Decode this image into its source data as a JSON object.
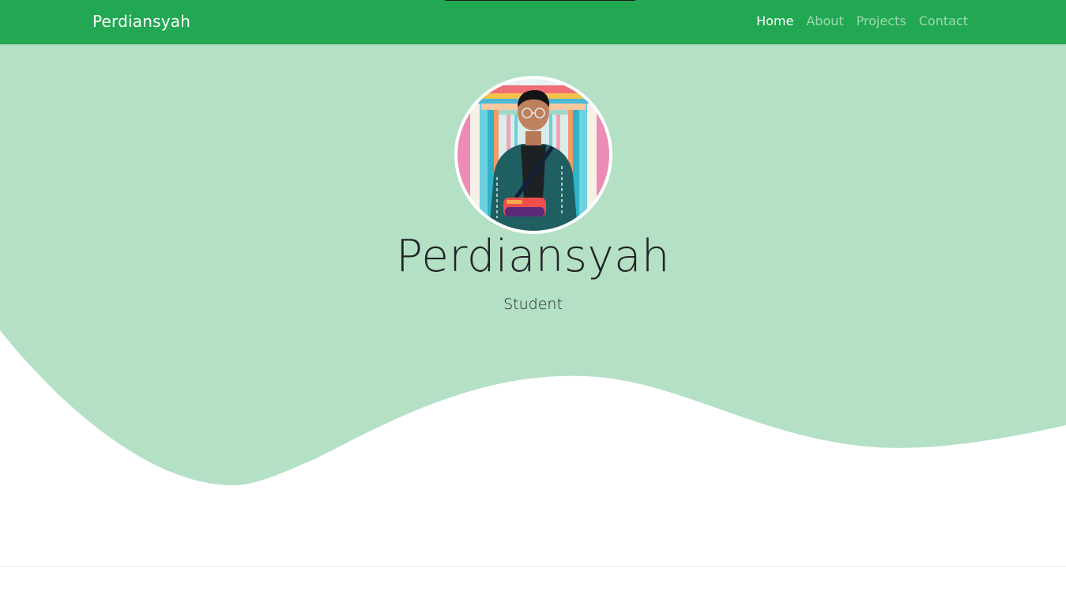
{
  "navbar": {
    "brand": "Perdiansyah",
    "links": [
      {
        "label": "Home",
        "active": true
      },
      {
        "label": "About",
        "active": false
      },
      {
        "label": "Projects",
        "active": false
      },
      {
        "label": "Contact",
        "active": false
      }
    ]
  },
  "hero": {
    "name": "Perdiansyah",
    "role": "Student",
    "profile_icon": "profile-photo"
  },
  "colors": {
    "navbar": "#22a853",
    "hero_background": "#b4e0c6",
    "text": "#222428",
    "page_background": "#ffffff"
  }
}
